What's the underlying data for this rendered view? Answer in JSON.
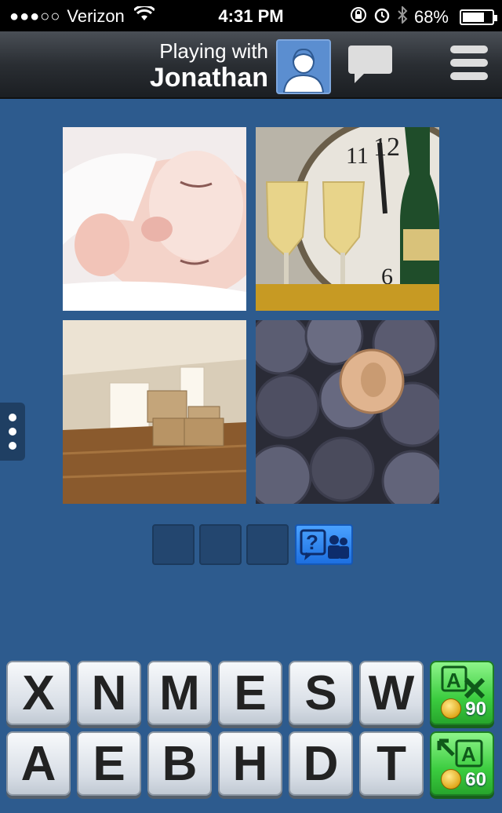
{
  "status_bar": {
    "signal": "●●●○○",
    "carrier": "Verizon",
    "time": "4:31 PM",
    "battery": "68%",
    "battery_level": 0.68
  },
  "header": {
    "playing_label": "Playing with",
    "opponent_name": "Jonathan"
  },
  "puzzle": {
    "images": [
      "sleeping-baby",
      "new-year-champagne-clock",
      "empty-room-boxes",
      "pennies"
    ],
    "answer_slots": 3
  },
  "keyboard": {
    "row1": [
      "X",
      "N",
      "M",
      "E",
      "S",
      "W"
    ],
    "row2": [
      "A",
      "E",
      "B",
      "H",
      "D",
      "T"
    ],
    "remove_letters": {
      "icon": "remove-letter-icon",
      "cost": "90"
    },
    "reveal_letter": {
      "icon": "reveal-letter-icon",
      "cost": "60"
    }
  },
  "colors": {
    "background": "#2d5b8e",
    "header": "#2a2e33",
    "help_button": "#1d6fe0",
    "power_button": "#3bcc3f"
  }
}
